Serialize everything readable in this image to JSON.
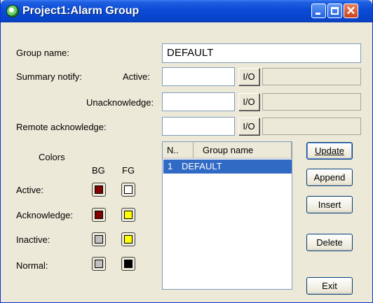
{
  "window": {
    "title": "Project1:Alarm Group"
  },
  "form": {
    "group_name_label": "Group name:",
    "group_name_value": "DEFAULT",
    "summary_notify_label": "Summary notify:",
    "active_label": "Active:",
    "unack_label": "Unacknowledge:",
    "remote_ack_label": "Remote acknowledge:",
    "io_label": "I/O"
  },
  "colors": {
    "heading": "Colors",
    "bg_header": "BG",
    "fg_header": "FG",
    "rows": [
      {
        "label": "Active:",
        "bg": "#800000",
        "fg": "#ffffff"
      },
      {
        "label": "Acknowledge:",
        "bg": "#800000",
        "fg": "#ffff00"
      },
      {
        "label": "Inactive:",
        "bg": "#c0c0c0",
        "fg": "#ffff00"
      },
      {
        "label": "Normal:",
        "bg": "#c0c0c0",
        "fg": "#000000"
      }
    ]
  },
  "list": {
    "headers": [
      "N..",
      "Group name"
    ],
    "rows": [
      {
        "n": "1",
        "name": "DEFAULT"
      }
    ]
  },
  "buttons": {
    "update": "Update",
    "append": "Append",
    "insert": "Insert",
    "delete": "Delete",
    "exit": "Exit"
  }
}
